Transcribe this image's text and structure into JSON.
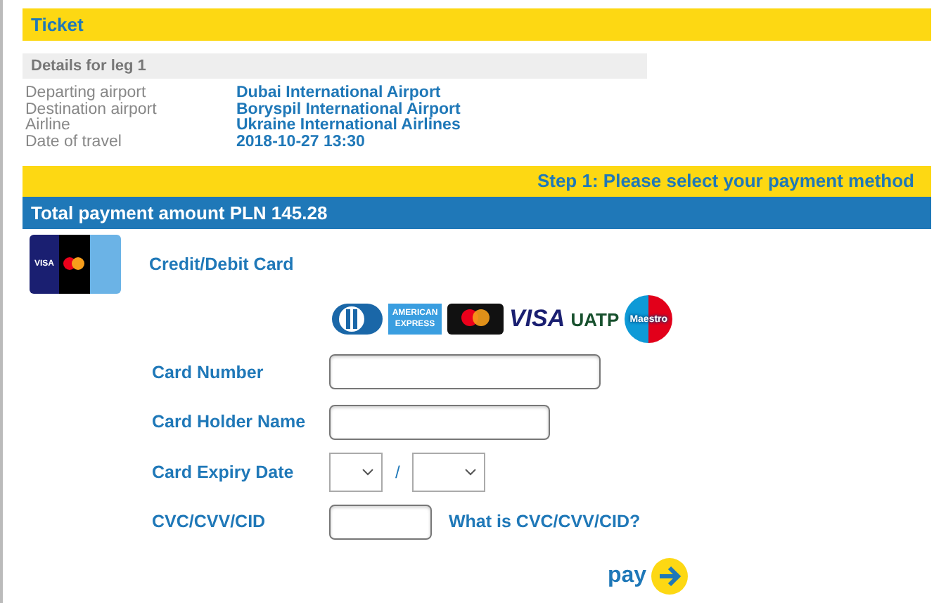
{
  "ticket": {
    "title": "Ticket",
    "leg_title": "Details for leg 1",
    "details": [
      {
        "label": "Departing airport",
        "value": "Dubai International Airport"
      },
      {
        "label": "Destination airport",
        "value": "Boryspil International Airport"
      },
      {
        "label": "Airline",
        "value": "Ukraine International Airlines"
      },
      {
        "label": "Date of travel",
        "value": "2018-10-27 13:30"
      }
    ]
  },
  "step": "Step 1: Please select your payment method",
  "total": "Total payment amount PLN 145.28",
  "method": {
    "icon_text": "VISA",
    "label": "Credit/Debit Card"
  },
  "card_logos": [
    {
      "kind": "diners"
    },
    {
      "kind": "amex",
      "text": "AMERICAN EXPRESS"
    },
    {
      "kind": "mastercard"
    },
    {
      "kind": "visa",
      "text": "VISA"
    },
    {
      "kind": "uatp",
      "text": "UATP"
    },
    {
      "kind": "maestro",
      "text": "Maestro"
    }
  ],
  "form": [
    {
      "kind": "number",
      "label": "Card Number"
    },
    {
      "kind": "name",
      "label": "Card Holder Name"
    },
    {
      "kind": "expiry",
      "label": "Card Expiry Date",
      "separator": "/"
    },
    {
      "kind": "cvc",
      "label": "CVC/CVV/CID",
      "help": "What is CVC/CVV/CID?"
    }
  ],
  "pay_button": "pay"
}
